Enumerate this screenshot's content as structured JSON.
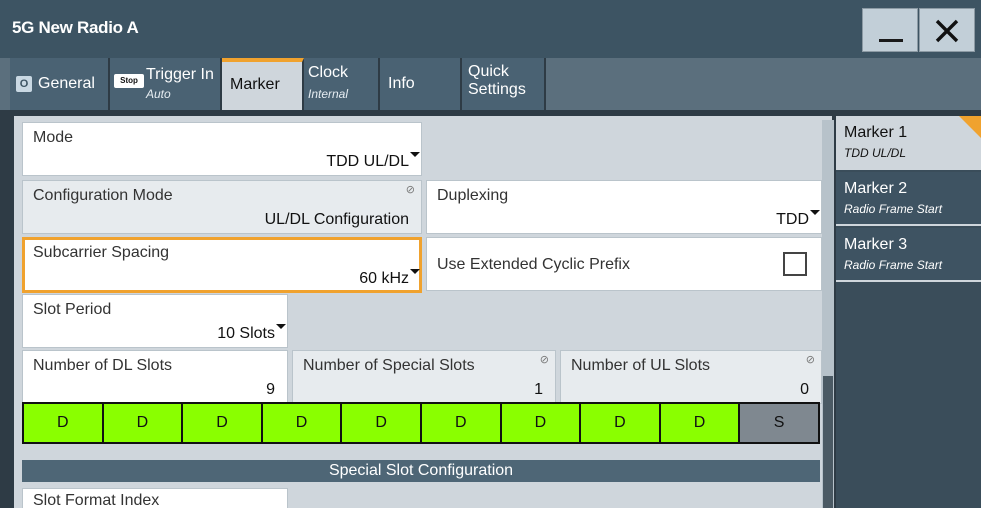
{
  "window": {
    "title": "5G New Radio A",
    "minimize_icon": "minimize-icon",
    "close_icon": "close-icon"
  },
  "tabs": [
    {
      "label": "General",
      "badge": "O"
    },
    {
      "label": "Trigger In",
      "badge": "Stop",
      "sub": "Auto"
    },
    {
      "label": "Marker",
      "active": true
    },
    {
      "label": "Clock",
      "sub": "Internal"
    },
    {
      "label": "Info"
    },
    {
      "label": "Quick",
      "label2": "Settings"
    }
  ],
  "form": {
    "mode": {
      "label": "Mode",
      "value": "TDD UL/DL"
    },
    "config_mode": {
      "label": "Configuration Mode",
      "value": "UL/DL Configuration"
    },
    "duplexing": {
      "label": "Duplexing",
      "value": "TDD"
    },
    "subcarrier": {
      "label": "Subcarrier Spacing",
      "value": "60 kHz"
    },
    "ext_cp": {
      "label": "Use Extended Cyclic Prefix",
      "checked": false
    },
    "slot_period": {
      "label": "Slot Period",
      "value": "10 Slots"
    },
    "dl_slots": {
      "label": "Number of DL Slots",
      "value": "9"
    },
    "special_slots": {
      "label": "Number of Special Slots",
      "value": "1"
    },
    "ul_slots": {
      "label": "Number of UL Slots",
      "value": "0"
    },
    "slot_pattern": [
      "D",
      "D",
      "D",
      "D",
      "D",
      "D",
      "D",
      "D",
      "D",
      "S"
    ],
    "special_section": "Special Slot Configuration",
    "slot_format_index": {
      "label": "Slot Format Index"
    }
  },
  "markers": [
    {
      "name": "Marker 1",
      "sub": "TDD UL/DL",
      "active": true
    },
    {
      "name": "Marker 2",
      "sub": "Radio Frame Start"
    },
    {
      "name": "Marker 3",
      "sub": "Radio Frame Start"
    }
  ],
  "colors": {
    "accent": "#f0a22e",
    "downlink_slot": "#8aff00",
    "special_slot": "#7f8890"
  }
}
